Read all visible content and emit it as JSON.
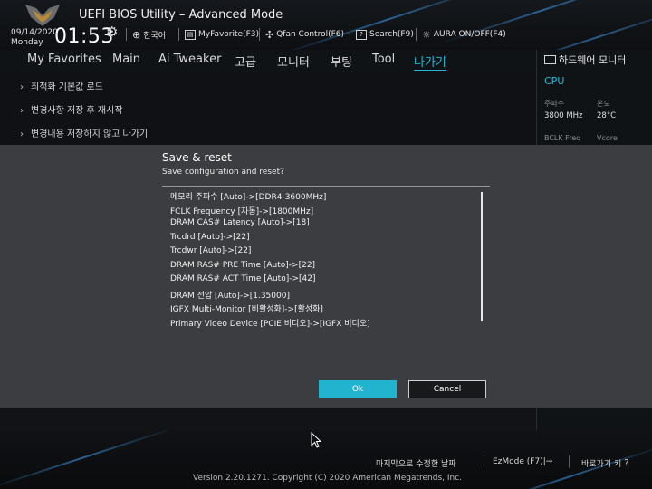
{
  "header": {
    "title": "UEFI BIOS Utility – Advanced Mode",
    "date": "09/14/2020",
    "day": "Monday",
    "time": "01:53",
    "items": [
      {
        "icon": "globe-icon",
        "label": "한국어"
      },
      {
        "icon": "myfavorite-icon",
        "label": "MyFavorite(F3)"
      },
      {
        "icon": "fan-icon",
        "label": "Qfan Control(F6)"
      },
      {
        "icon": "search-icon",
        "label": "Search(F9)"
      },
      {
        "icon": "aura-icon",
        "label": "AURA ON/OFF(F4)"
      }
    ]
  },
  "tabs": [
    "My Favorites",
    "Main",
    "Ai Tweaker",
    "고급",
    "모니터",
    "부팅",
    "Tool",
    "나가기"
  ],
  "active_tab": "나가기",
  "menu": [
    "최적화 기본값 로드",
    "변경사항 저장 후 재시작",
    "변경내용 저장하지 않고  나가기"
  ],
  "hw_monitor": {
    "title": "하드웨어 모니터",
    "section": "CPU",
    "freq_label": "주파수",
    "freq_value": "3800 MHz",
    "temp_label": "온도",
    "temp_value": "28°C",
    "bclk_label": "BCLK Freq",
    "vcore_label": "Vcore"
  },
  "dialog": {
    "title": "Save & reset",
    "subtitle": "Save configuration and reset?",
    "changes": [
      "메모리 주파수 [Auto]->[DDR4-3600MHz]",
      "FCLK Frequency [자동]->[1800MHz]",
      "DRAM CAS# Latency [Auto]->[18]",
      "Trcdrd [Auto]->[22]",
      "Trcdwr [Auto]->[22]",
      "DRAM RAS# PRE Time [Auto]->[22]",
      "DRAM RAS# ACT Time [Auto]->[42]",
      "DRAM 전압 [Auto]->[1.35000]",
      "IGFX Multi-Monitor [비활성화]->[활성화]",
      "Primary Video Device [PCIE 비디오]->[IGFX 비디오]"
    ],
    "ok_label": "Ok",
    "cancel_label": "Cancel"
  },
  "footer": {
    "last_modified": "마지막으로 수정한 날짜",
    "ezmode": "EzMode (F7)|→",
    "hotkeys": "바로가기 키",
    "version": "Version 2.20.1271. Copyright (C) 2020 American Megatrends, Inc."
  },
  "colors": {
    "accent": "#22b6d6",
    "ok_button": "#22b3cf",
    "overlay": "#3b3d40"
  }
}
